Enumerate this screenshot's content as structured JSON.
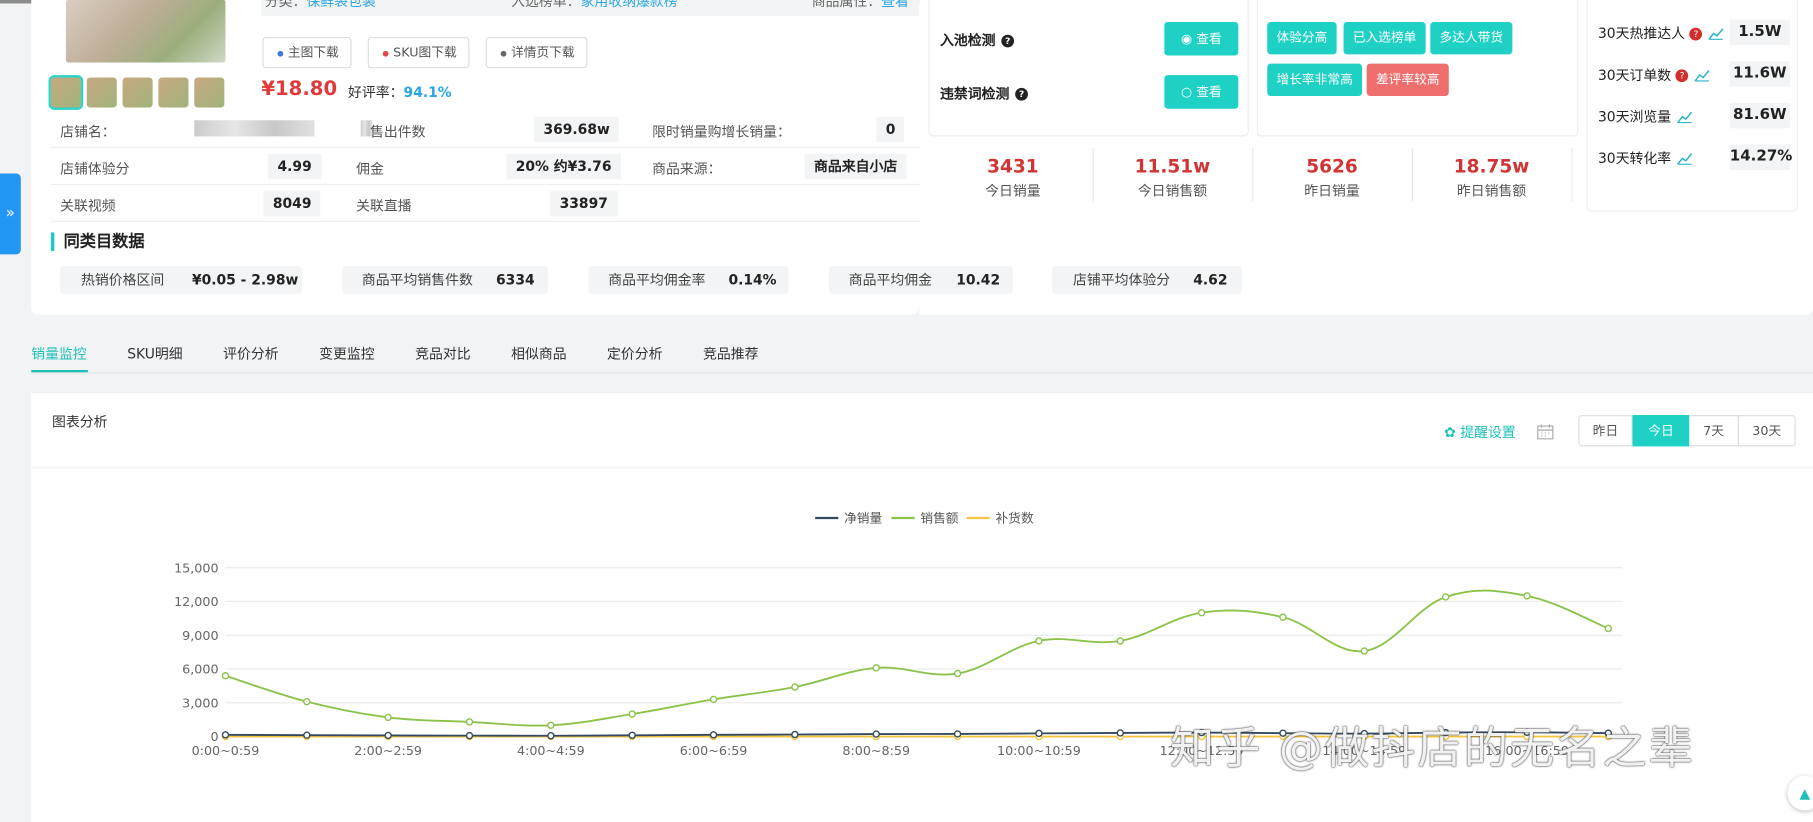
{
  "header": {
    "category_label": "分类：",
    "category_value": "保鲜袋包装",
    "rank_label": "入选榜单：",
    "rank_value": "家用收纳爆款榜",
    "attr_label": "商品属性：",
    "attr_value": "查看"
  },
  "downloads": [
    {
      "label": "主图下载",
      "dot_color": "#3a7bd5"
    },
    {
      "label": "SKU图下载",
      "dot_color": "#e04848"
    },
    {
      "label": "详情页下载",
      "dot_color": "#666666"
    }
  ],
  "product": {
    "price": "¥18.80",
    "good_rate_label": "好评率：",
    "good_rate_value": "94.1%"
  },
  "info_rows": [
    [
      {
        "label": "店铺名：",
        "value": ""
      },
      {
        "label": "售出件数",
        "value": "369.68w"
      },
      {
        "label": "限时销量购增长销量：",
        "value": "0"
      }
    ],
    [
      {
        "label": "店铺体验分",
        "value": "4.99"
      },
      {
        "label": "佣金",
        "value": "20% 约¥3.76"
      },
      {
        "label": "商品来源：",
        "value": "商品来自小店"
      }
    ],
    [
      {
        "label": "关联视频",
        "value": "8049"
      },
      {
        "label": "关联直播",
        "value": "33897"
      }
    ]
  ],
  "category_stats": {
    "title": "同类目数据",
    "items": [
      {
        "label": "热销价格区间",
        "value": "¥0.05 - 2.98w"
      },
      {
        "label": "商品平均销售件数",
        "value": "6334"
      },
      {
        "label": "商品平均佣金率",
        "value": "0.14%"
      },
      {
        "label": "商品平均佣金",
        "value": "10.42"
      },
      {
        "label": "店铺平均体验分",
        "value": "4.62"
      }
    ]
  },
  "checks": {
    "pool_label": "入池检测",
    "pool_btn": "查看",
    "banned_label": "违禁词检测",
    "banned_btn": "查看"
  },
  "tags": [
    {
      "label": "体验分高",
      "color": "#1fd1c5"
    },
    {
      "label": "已入选榜单",
      "color": "#1fd1c5"
    },
    {
      "label": "多达人带货",
      "color": "#1fd1c5"
    },
    {
      "label": "增长率非常高",
      "color": "#1fd1c5"
    },
    {
      "label": "差评率较高",
      "color": "#ef6f6f"
    }
  ],
  "kpis": [
    {
      "value": "3431",
      "label": "今日销量"
    },
    {
      "value": "11.51w",
      "label": "今日销售额"
    },
    {
      "value": "5626",
      "label": "昨日销量"
    },
    {
      "value": "18.75w",
      "label": "昨日销售额"
    }
  ],
  "stats_30d": [
    {
      "label": "30天热推达人",
      "value": "1.5W",
      "has_help": true
    },
    {
      "label": "30天订单数",
      "value": "11.6W",
      "has_help": true
    },
    {
      "label": "30天浏览量",
      "value": "81.6W",
      "has_help": false
    },
    {
      "label": "30天转化率",
      "value": "14.27%",
      "has_help": false
    }
  ],
  "tabs": [
    "销量监控",
    "SKU明细",
    "评价分析",
    "变更监控",
    "竞品对比",
    "相似商品",
    "定价分析",
    "竞品推荐"
  ],
  "active_tab": 0,
  "chart_panel": {
    "title": "图表分析",
    "remind_label": "提醒设置",
    "ranges": [
      "昨日",
      "今日",
      "7天",
      "30天"
    ],
    "active_range": 1
  },
  "chart_data": {
    "type": "line",
    "x": [
      "0:00~0:59",
      "1:00~1:59",
      "2:00~2:59",
      "3:00~3:59",
      "4:00~4:59",
      "5:00~5:59",
      "6:00~6:59",
      "7:00~7:59",
      "8:00~8:59",
      "9:00~9:59",
      "10:00~10:59",
      "11:00~11:59",
      "12:00~12:59",
      "13:00~13:59",
      "14:00~14:59",
      "15:00~15:59",
      "16:00~16:59",
      "17:00~17:59"
    ],
    "x_tick_labels": [
      "0:00~0:59",
      "",
      "2:00~2:59",
      "",
      "4:00~4:59",
      "",
      "6:00~6:59",
      "",
      "8:00~8:59",
      "",
      "10:00~10:59",
      "",
      "12:00~12:59",
      "",
      "14:00~14:59",
      "",
      "16:00~16:59",
      ""
    ],
    "yticks": [
      "0",
      "3,000",
      "6,000",
      "9,000",
      "12,000",
      "15,000"
    ],
    "ylim": [
      0,
      15000
    ],
    "grid": true,
    "legend_position": "top-center",
    "series": [
      {
        "name": "净销量",
        "color": "#34495e",
        "values": [
          150,
          120,
          100,
          80,
          70,
          110,
          150,
          180,
          220,
          230,
          280,
          320,
          350,
          300,
          260,
          350,
          380,
          300
        ]
      },
      {
        "name": "销售额",
        "color": "#8bc34a",
        "values": [
          5400,
          3100,
          1700,
          1300,
          1000,
          2000,
          3300,
          4400,
          6100,
          5600,
          8500,
          8500,
          11000,
          10600,
          7600,
          12400,
          12500,
          9600
        ]
      },
      {
        "name": "补货数",
        "color": "#f5c542",
        "values": [
          0,
          0,
          0,
          0,
          0,
          0,
          0,
          0,
          0,
          0,
          0,
          0,
          0,
          0,
          0,
          0,
          0,
          0
        ]
      }
    ]
  },
  "watermark": "知乎 @做抖店的无名之辈"
}
